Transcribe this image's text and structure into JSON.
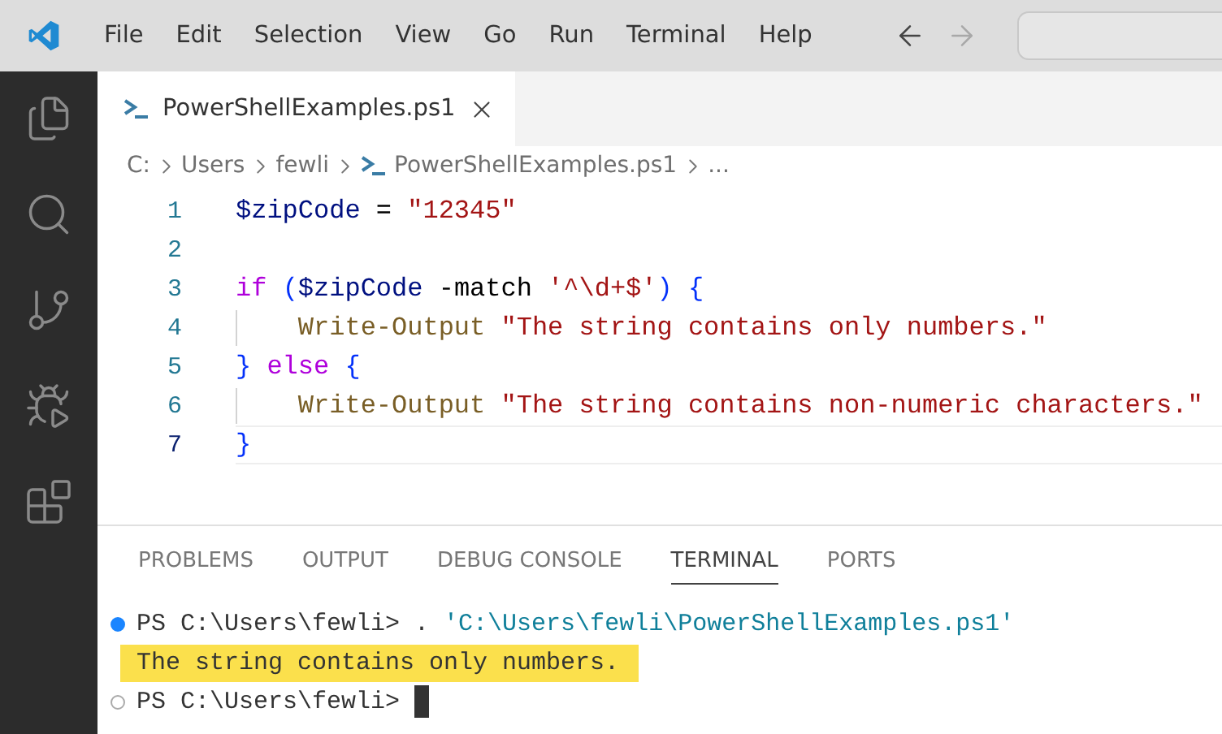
{
  "menu": [
    "File",
    "Edit",
    "Selection",
    "View",
    "Go",
    "Run",
    "Terminal",
    "Help"
  ],
  "navigation": [
    {
      "kind": "back",
      "disabled": false
    },
    {
      "kind": "forward",
      "disabled": true
    }
  ],
  "editor_tabs": [
    {
      "label": "PowerShellExamples.ps1",
      "selected": true
    }
  ],
  "breadcrumb": [
    {
      "label": "C:",
      "kind": "folder"
    },
    {
      "label": "Users",
      "kind": "folder"
    },
    {
      "label": "fewli",
      "kind": "folder"
    },
    {
      "label": "PowerShellExamples.ps1",
      "kind": "file"
    },
    {
      "label": "...",
      "kind": "more"
    }
  ],
  "code_lines": [
    {
      "number": "1",
      "guide": false,
      "current": false,
      "tokens": [
        {
          "kind": "variable",
          "text": "$zipCode"
        },
        {
          "kind": "plain",
          "text": " = "
        },
        {
          "kind": "string",
          "text": "\"12345\""
        }
      ]
    },
    {
      "number": "2",
      "guide": false,
      "current": false
    },
    {
      "number": "3",
      "guide": false,
      "current": false,
      "tokens": [
        {
          "kind": "keyword",
          "text": "if "
        },
        {
          "kind": "bracket",
          "text": "("
        },
        {
          "kind": "variable",
          "text": "$zipCode"
        },
        {
          "kind": "plain",
          "text": " -match "
        },
        {
          "kind": "string",
          "text": "'^\\d+$'"
        },
        {
          "kind": "bracket",
          "text": ")"
        },
        {
          "kind": "bracket",
          "text": " {"
        }
      ]
    },
    {
      "number": "4",
      "guide": true,
      "current": false,
      "tokens": [
        {
          "kind": "function",
          "text": "Write-Output "
        },
        {
          "kind": "string",
          "text": "\"The string contains only numbers.\""
        }
      ]
    },
    {
      "number": "5",
      "guide": false,
      "current": false,
      "tokens": [
        {
          "kind": "bracket",
          "text": "} "
        },
        {
          "kind": "keyword",
          "text": "else "
        },
        {
          "kind": "bracket",
          "text": "{"
        }
      ]
    },
    {
      "number": "6",
      "guide": true,
      "current": false,
      "tokens": [
        {
          "kind": "function",
          "text": "Write-Output "
        },
        {
          "kind": "string",
          "text": "\"The string contains non-numeric characters.\""
        }
      ]
    },
    {
      "number": "7",
      "guide": false,
      "current": true,
      "tokens": [
        {
          "kind": "bracket",
          "text": "}"
        }
      ]
    }
  ],
  "panel_tabs": [
    {
      "label": "PROBLEMS",
      "selected": false
    },
    {
      "label": "OUTPUT",
      "selected": false
    },
    {
      "label": "DEBUG CONSOLE",
      "selected": false
    },
    {
      "label": "TERMINAL",
      "selected": true
    },
    {
      "label": "PORTS",
      "selected": false
    }
  ],
  "terminal_lines": [
    {
      "kind": "command",
      "filled_dot": true,
      "prompt": "PS C:\\Users\\fewli> ",
      "command": ". ",
      "argument": "'C:\\Users\\fewli\\PowerShellExamples.ps1'"
    },
    {
      "kind": "output",
      "highlighted": true,
      "text": "The string contains only numbers."
    },
    {
      "kind": "command",
      "filled_dot": false,
      "prompt": "PS C:\\Users\\fewli>",
      "cursor": true
    }
  ]
}
